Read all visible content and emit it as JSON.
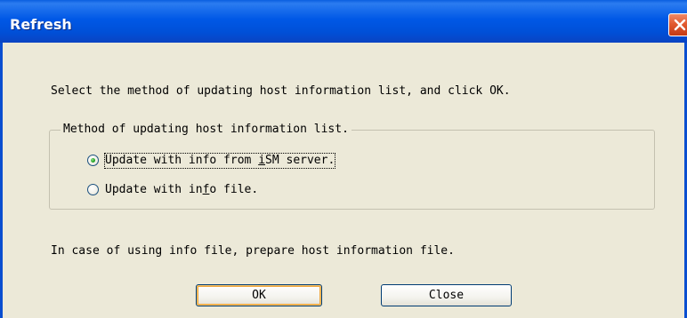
{
  "window": {
    "title": "Refresh"
  },
  "dialog": {
    "instruction": "Select the method of updating host information list, and click OK.",
    "group": {
      "legend": "Method of updating host information list.",
      "options": [
        {
          "pre": "Update with info from ",
          "accel": "i",
          "post": "SM server.",
          "selected": true
        },
        {
          "pre": "Update with in",
          "accel": "f",
          "post": "o file.",
          "selected": false
        }
      ]
    },
    "note": "In case of using info file, prepare host information file."
  },
  "buttons": {
    "ok_label": "OK",
    "close_label": "Close"
  },
  "colors": {
    "titlebar": "#0058e6",
    "face": "#ece9d8",
    "close_button": "#e25a30"
  }
}
